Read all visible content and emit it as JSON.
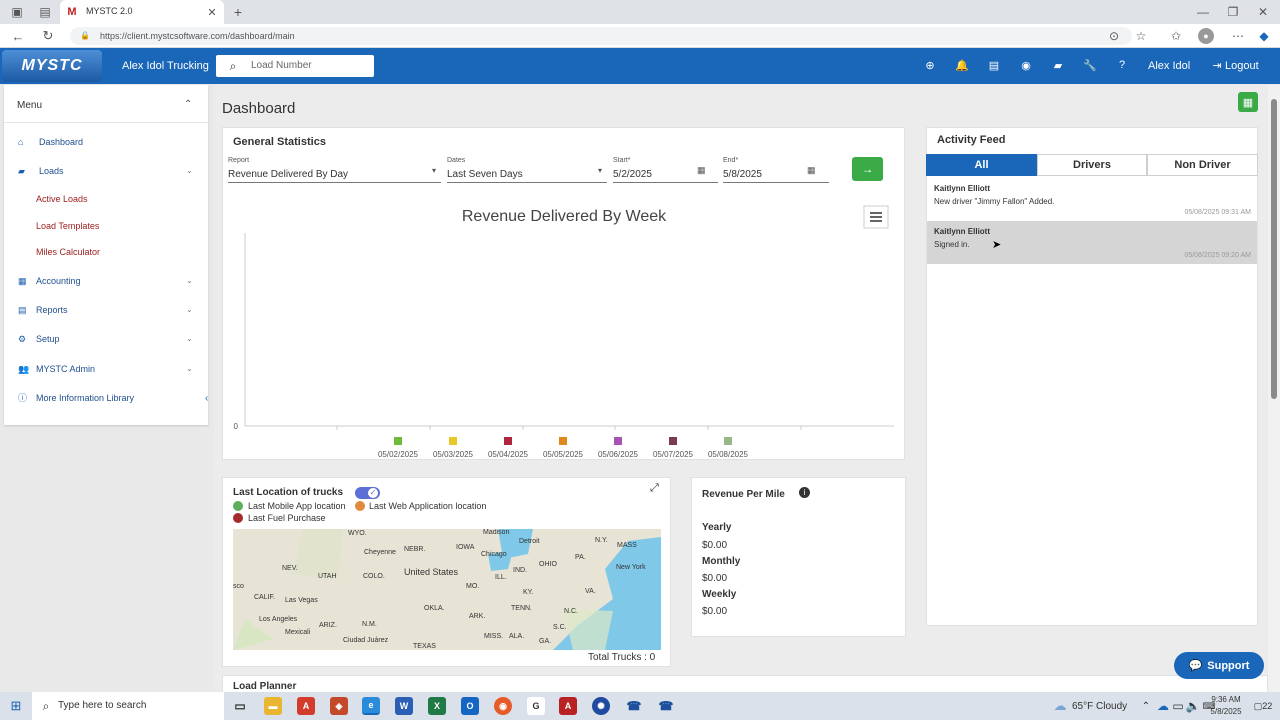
{
  "browser": {
    "tab_title": "MYSTC 2.0",
    "url": "https://client.mystcsoftware.com/dashboard/main"
  },
  "header": {
    "logo": "MYSTC",
    "company": "Alex Idol Trucking",
    "search_placeholder": "Load Number",
    "user": "Alex Idol",
    "logout": "Logout"
  },
  "sidebar": {
    "title": "Menu",
    "items": [
      {
        "label": "Dashboard"
      },
      {
        "label": "Loads"
      },
      {
        "label": "Accounting"
      },
      {
        "label": "Reports"
      },
      {
        "label": "Setup"
      },
      {
        "label": "MYSTC Admin"
      },
      {
        "label": "More Information Library"
      }
    ],
    "load_subitems": [
      {
        "label": "Active Loads"
      },
      {
        "label": "Load Templates"
      },
      {
        "label": "Miles Calculator"
      }
    ]
  },
  "page": {
    "title": "Dashboard"
  },
  "general_stats": {
    "title": "General Statistics",
    "report_label": "Report",
    "report_value": "Revenue Delivered By Day",
    "dates_label": "Dates",
    "dates_value": "Last Seven Days",
    "start_label": "Start*",
    "start_value": "5/2/2025",
    "end_label": "End*",
    "end_value": "5/8/2025"
  },
  "chart_data": {
    "type": "bar",
    "title": "Revenue Delivered By Week",
    "categories": [
      "05/02/2025",
      "05/03/2025",
      "05/04/2025",
      "05/05/2025",
      "05/06/2025",
      "05/07/2025",
      "05/08/2025"
    ],
    "values": [
      0,
      0,
      0,
      0,
      0,
      0,
      0
    ],
    "legend_colors": [
      "#6cbb3c",
      "#e8c72a",
      "#b0263f",
      "#e08a1e",
      "#a653b4",
      "#7a3c4c",
      "#9bb58a"
    ],
    "y_tick_labels": [
      "0"
    ],
    "grid": false
  },
  "trucks": {
    "title": "Last Location of trucks",
    "legend": [
      {
        "label": "Last Mobile App location",
        "color": "#5aaf5a"
      },
      {
        "label": "Last Web Application location",
        "color": "#e08a3c"
      },
      {
        "label": "Last Fuel Purchase",
        "color": "#a32b2b"
      }
    ],
    "total": "Total Trucks : 0",
    "map_labels": {
      "wyo": "WYO.",
      "nebr": "NEBR.",
      "iowa": "IOWA",
      "madison": "Madison",
      "detroit": "Detroit",
      "ny": "N.Y.",
      "mass": "MASS",
      "cheyenne": "Cheyenne",
      "chicago": "Chicago",
      "pa": "PA.",
      "nev": "NEV.",
      "utah": "UTAH",
      "colo": "COLO.",
      "us": "United States",
      "ind": "IND.",
      "ohio": "OHIO",
      "newyork": "New York",
      "mo": "MO.",
      "calif": "CALIF.",
      "lasvegas": "Las Vegas",
      "ky": "KY.",
      "va": "VA.",
      "sco": "sco",
      "okla": "OKLA.",
      "ark": "ARK.",
      "tenn": "TENN.",
      "nc": "N.C.",
      "losangeles": "Los Angeles",
      "nm": "N.M.",
      "ariz": "ARIZ.",
      "mexicali": "Mexicali",
      "sc": "S.C.",
      "ciudad": "Ciudad Juárez",
      "miss": "MISS.",
      "ala": "ALA.",
      "ga": "GA.",
      "texas": "TEXAS",
      "ill": "ILL."
    }
  },
  "revenue_per_mile": {
    "title": "Revenue Per Mile",
    "yearly_label": "Yearly",
    "yearly_value": "$0.00",
    "monthly_label": "Monthly",
    "monthly_value": "$0.00",
    "weekly_label": "Weekly",
    "weekly_value": "$0.00"
  },
  "load_planner": {
    "title": "Load Planner"
  },
  "activity": {
    "title": "Activity Feed",
    "tabs": [
      "All",
      "Drivers",
      "Non Driver"
    ],
    "items": [
      {
        "name": "Kaitlynn Elliott",
        "message": "New driver \"Jimmy Fallon\" Added.",
        "time": "05/08/2025 09:31 AM"
      },
      {
        "name": "Kaitlynn Elliott",
        "message": "Signed in.",
        "time": "05/08/2025 09:20 AM"
      }
    ]
  },
  "support": {
    "label": "Support"
  },
  "taskbar": {
    "search_placeholder": "Type here to search",
    "weather": "65°F  Cloudy",
    "time": "9:36 AM",
    "date": "5/8/2025",
    "notif_count": "22"
  },
  "colors": {
    "brand": "#1a66b8",
    "go": "#3aaa46",
    "active_tab": "#1a66b8"
  }
}
